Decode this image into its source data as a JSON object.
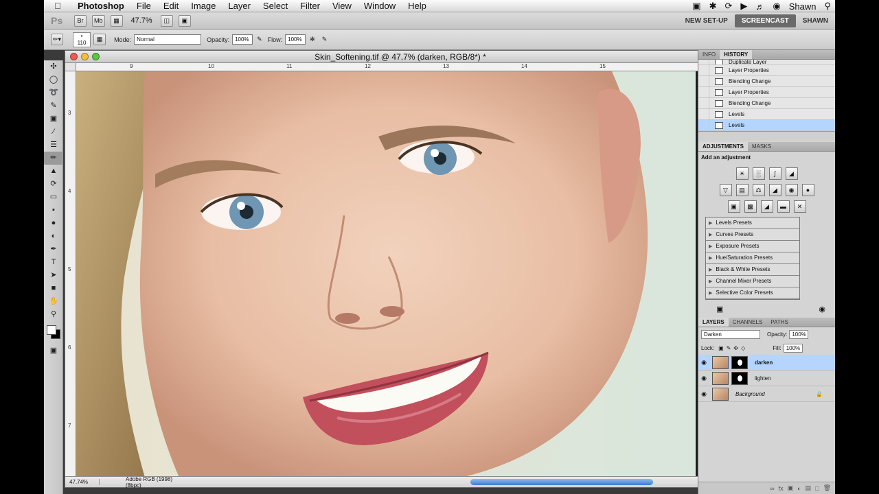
{
  "menubar": {
    "apple": "",
    "app": "Photoshop",
    "items": [
      "File",
      "Edit",
      "Image",
      "Layer",
      "Select",
      "Filter",
      "View",
      "Window",
      "Help"
    ],
    "user": "Shawn",
    "right_icons": [
      "camera-icon",
      "bluetooth-icon",
      "sync-icon",
      "play-icon",
      "volume-icon",
      "user-icon",
      "search-icon"
    ]
  },
  "appbar": {
    "logo": "Ps",
    "bridge": "Br",
    "minibridge": "Mb",
    "zoom": "47.7%",
    "workspaces": [
      "NEW SET-UP",
      "SCREENCAST",
      "SHAWN"
    ],
    "active_workspace": "SCREENCAST"
  },
  "options": {
    "brush_size": "110",
    "mode_label": "Mode:",
    "mode_value": "Normal",
    "opacity_label": "Opacity:",
    "opacity_value": "100%",
    "flow_label": "Flow:",
    "flow_value": "100%"
  },
  "document": {
    "title": "Skin_Softening.tif @ 47.7% (darken, RGB/8*) *",
    "ruler_h": [
      "9",
      "10",
      "11",
      "12",
      "13",
      "14",
      "15"
    ],
    "ruler_v": [
      "3",
      "4",
      "5",
      "6",
      "7"
    ],
    "status_zoom": "47.74%",
    "status_profile": "Adobe RGB (1998) (8bpc)"
  },
  "history": {
    "tabs": [
      "INFO",
      "HISTORY"
    ],
    "active_tab": "HISTORY",
    "items": [
      "Duplicate Layer",
      "Layer Properties",
      "Blending Change",
      "Layer Properties",
      "Blending Change",
      "Levels",
      "Levels"
    ]
  },
  "adjustments": {
    "tabs": [
      "ADJUSTMENTS",
      "MASKS"
    ],
    "active_tab": "ADJUSTMENTS",
    "title": "Add an adjustment",
    "presets": [
      "Levels Presets",
      "Curves Presets",
      "Exposure Presets",
      "Hue/Saturation Presets",
      "Black & White Presets",
      "Channel Mixer Presets",
      "Selective Color Presets"
    ]
  },
  "layers": {
    "tabs": [
      "LAYERS",
      "CHANNELS",
      "PATHS"
    ],
    "active_tab": "LAYERS",
    "blend_mode": "Darken",
    "opacity_label": "Opacity:",
    "opacity": "100%",
    "lock_label": "Lock:",
    "fill_label": "Fill:",
    "fill": "100%",
    "items": [
      {
        "name": "darken",
        "selected": true
      },
      {
        "name": "lighten",
        "selected": false
      },
      {
        "name": "Background",
        "selected": false
      }
    ]
  },
  "colors": {
    "selection": "#b5d5ff",
    "accent": "#3d7bd0"
  }
}
